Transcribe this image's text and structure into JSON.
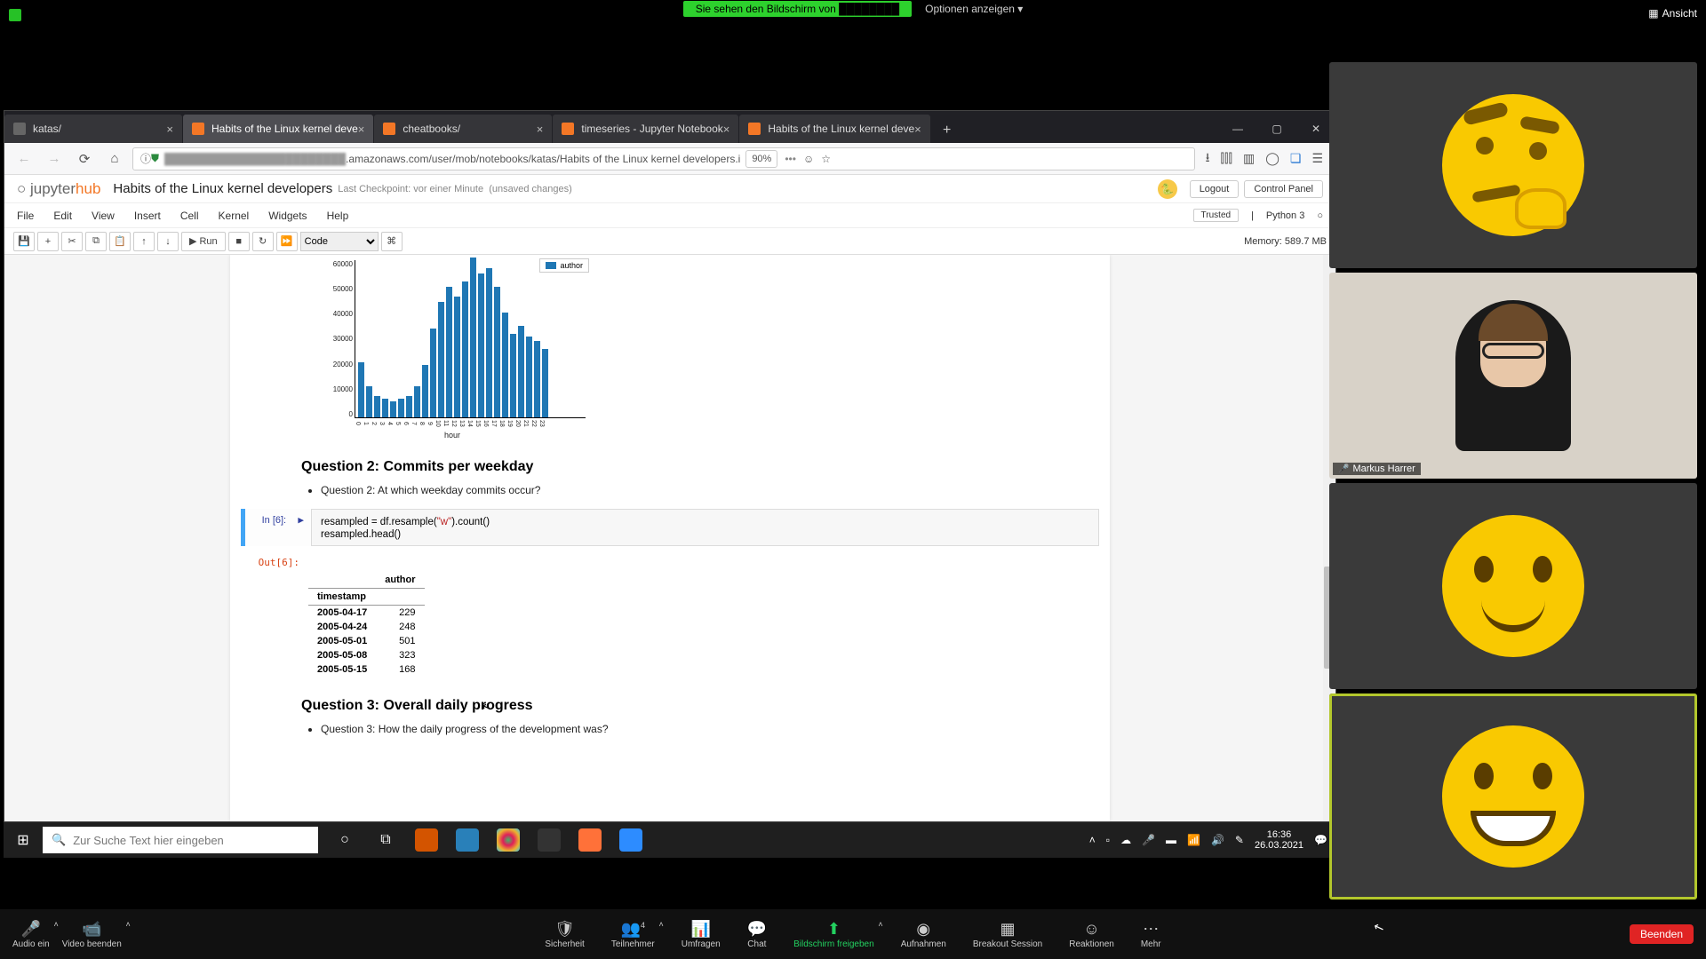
{
  "top": {
    "share_text": "Sie sehen den Bildschirm von",
    "options": "Optionen anzeigen ▾",
    "view": "Ansicht"
  },
  "tabs": [
    {
      "label": "katas/",
      "fav": "alt"
    },
    {
      "label": "Habits of the Linux kernel deve",
      "fav": "j",
      "active": true
    },
    {
      "label": "cheatbooks/",
      "fav": "j"
    },
    {
      "label": "timeseries - Jupyter Notebook",
      "fav": "j"
    },
    {
      "label": "Habits of the Linux kernel deve",
      "fav": "j"
    }
  ],
  "url": ".amazonaws.com/user/mob/notebooks/katas/Habits of the Linux kernel developers.i",
  "zoom": "90%",
  "jupyter": {
    "logo1": "jupyter",
    "logo2": "hub",
    "title": "Habits of the Linux kernel developers",
    "checkpoint": "Last Checkpoint: vor einer Minute",
    "unsaved": "(unsaved changes)",
    "logout": "Logout",
    "cpanel": "Control Panel",
    "menus": [
      "File",
      "Edit",
      "View",
      "Insert",
      "Cell",
      "Kernel",
      "Widgets",
      "Help"
    ],
    "trusted": "Trusted",
    "kernel": "Python 3",
    "run": "Run",
    "celltype": "Code",
    "memory": "Memory: 589.7 MB"
  },
  "chart_data": {
    "type": "bar",
    "legend": "author",
    "xlabel": "hour",
    "categories": [
      "0",
      "1",
      "2",
      "3",
      "4",
      "5",
      "6",
      "7",
      "8",
      "9",
      "10",
      "11",
      "12",
      "13",
      "14",
      "15",
      "16",
      "17",
      "18",
      "19",
      "20",
      "21",
      "22",
      "23"
    ],
    "values": [
      21000,
      12000,
      8000,
      7000,
      6000,
      7000,
      8000,
      12000,
      20000,
      34000,
      44000,
      50000,
      46000,
      52000,
      61000,
      55000,
      57000,
      50000,
      40000,
      32000,
      35000,
      31000,
      29000,
      26000
    ],
    "ylim": [
      0,
      60000
    ],
    "yticks": [
      "60000",
      "50000",
      "40000",
      "30000",
      "20000",
      "10000",
      "0"
    ]
  },
  "q2": {
    "heading": "Question 2: Commits per weekday",
    "bullet": "Question 2: At which weekday commits occur?"
  },
  "code": {
    "in_prompt": "In [6]:",
    "out_prompt": "Out[6]:",
    "line1a": "resampled = df.resample(",
    "line1s": "\"w\"",
    "line1b": ").count()",
    "line2": "resampled.head()"
  },
  "table": {
    "colhdr": "author",
    "rowhdr": "timestamp",
    "rows": [
      {
        "ts": "2005-04-17",
        "v": "229"
      },
      {
        "ts": "2005-04-24",
        "v": "248"
      },
      {
        "ts": "2005-05-01",
        "v": "501"
      },
      {
        "ts": "2005-05-08",
        "v": "323"
      },
      {
        "ts": "2005-05-15",
        "v": "168"
      }
    ]
  },
  "q3": {
    "heading": "Question 3: Overall daily progress",
    "bullet": "Question 3: How the daily progress of the development was?"
  },
  "participants": {
    "name2": "Markus Harrer"
  },
  "zoom_controls": {
    "audio": "Audio ein",
    "video": "Video beenden",
    "security": "Sicherheit",
    "participants": "Teilnehmer",
    "pcount": "4",
    "polls": "Umfragen",
    "chat": "Chat",
    "share": "Bildschirm freigeben",
    "record": "Aufnahmen",
    "breakout": "Breakout Session",
    "reactions": "Reaktionen",
    "more": "Mehr",
    "end": "Beenden"
  },
  "taskbar": {
    "search": "Zur Suche Text hier eingeben",
    "time": "16:36",
    "date": "26.03.2021"
  }
}
